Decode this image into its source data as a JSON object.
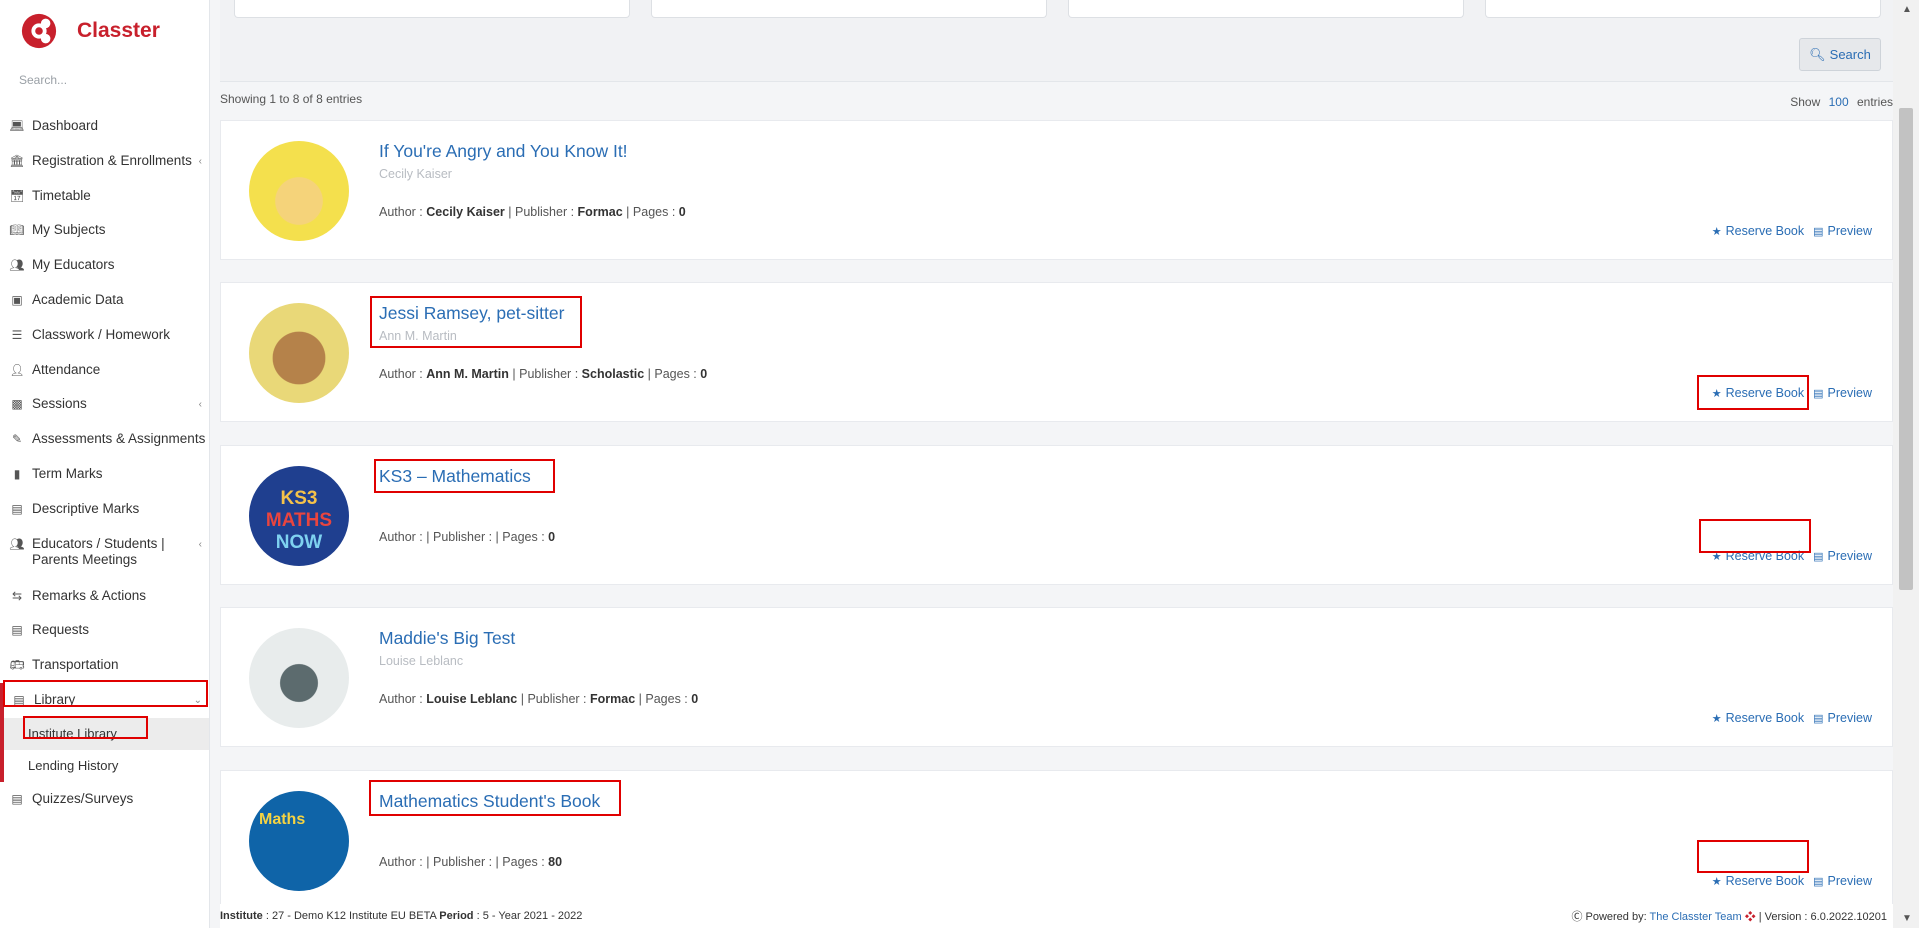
{
  "brand": {
    "name": "Classter"
  },
  "sidebar": {
    "search_placeholder": "Search...",
    "items": [
      {
        "label": "Dashboard",
        "icon": "laptop-icon"
      },
      {
        "label": "Registration & Enrollments",
        "icon": "institution-icon",
        "has_chevron": true
      },
      {
        "label": "Timetable",
        "icon": "calendar-icon"
      },
      {
        "label": "My Subjects",
        "icon": "book-open-icon"
      },
      {
        "label": "My Educators",
        "icon": "users-icon"
      },
      {
        "label": "Academic Data",
        "icon": "chalkboard-icon"
      },
      {
        "label": "Classwork / Homework",
        "icon": "tasks-icon"
      },
      {
        "label": "Attendance",
        "icon": "user-times-icon"
      },
      {
        "label": "Sessions",
        "icon": "sessions-icon",
        "has_chevron": true
      },
      {
        "label": "Assessments & Assignments",
        "icon": "edit-icon"
      },
      {
        "label": "Term Marks",
        "icon": "book-icon"
      },
      {
        "label": "Descriptive Marks",
        "icon": "chart-icon"
      },
      {
        "label": "Educators / Students | Parents Meetings",
        "icon": "meeting-icon",
        "has_chevron": true
      },
      {
        "label": "Remarks & Actions",
        "icon": "random-icon"
      },
      {
        "label": "Requests",
        "icon": "file-icon"
      },
      {
        "label": "Transportation",
        "icon": "bus-icon"
      }
    ],
    "library": {
      "label": "Library",
      "icon": "library-icon",
      "children": [
        "Institute Library",
        "Lending History"
      ]
    },
    "after_library": [
      {
        "label": "Quizzes/Surveys",
        "icon": "survey-icon"
      }
    ]
  },
  "filters": {
    "search_button": "Search"
  },
  "listing": {
    "showing": "Showing 1 to 8 of 8 entries",
    "show_label": "Show",
    "show_count": "100",
    "entries_label": "entries"
  },
  "books": [
    {
      "title": "If You're Angry and You Know It!",
      "subauthor": "Cecily Kaiser",
      "author": "Cecily Kaiser",
      "publisher": "Formac",
      "pages": "0"
    },
    {
      "title": "Jessi Ramsey, pet-sitter",
      "subauthor": "Ann M. Martin",
      "author": "Ann M. Martin",
      "publisher": "Scholastic",
      "pages": "0"
    },
    {
      "title": "KS3 – Mathematics",
      "subauthor": "",
      "author": "",
      "publisher": "",
      "pages": "0"
    },
    {
      "title": "Maddie's Big Test",
      "subauthor": "Louise Leblanc",
      "author": "Louise Leblanc",
      "publisher": "Formac",
      "pages": "0"
    },
    {
      "title": "Mathematics Student's Book",
      "subauthor": "",
      "author": "",
      "publisher": "",
      "pages": "80"
    }
  ],
  "labels": {
    "author": "Author :",
    "publisher": "Publisher :",
    "pages": "Pages :",
    "reserve": "Reserve Book",
    "preview": "Preview"
  },
  "footer": {
    "institute_label": "Institute",
    "institute_value": ": 27 - Demo K12 Institute EU BETA",
    "period_label": "Period",
    "period_value": ": 5 - Year 2021 - 2022",
    "powered_by": "Powered by:",
    "team": "The Classter Team",
    "version": "| Version : 6.0.2022.10201"
  },
  "colors": {
    "brand": "#c8202c",
    "link": "#2a6db4",
    "highlight": "#e00000"
  }
}
